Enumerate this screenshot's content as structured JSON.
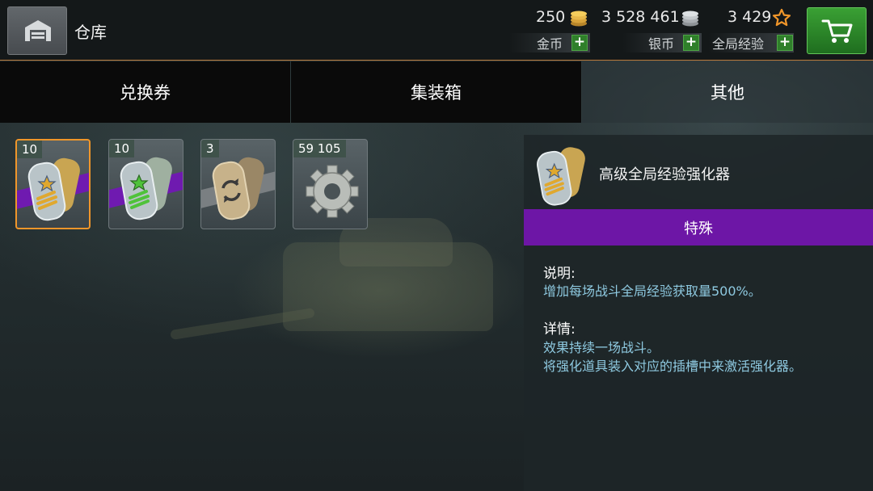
{
  "header": {
    "title": "仓库",
    "gold": {
      "value": "250",
      "label": "金币"
    },
    "silver": {
      "value": "3 528 461",
      "label": "银币"
    },
    "xp": {
      "value": "3 429",
      "label": "全局经验"
    },
    "plus": "+"
  },
  "tabs": [
    {
      "label": "兑换券",
      "active": false
    },
    {
      "label": "集装箱",
      "active": false
    },
    {
      "label": "其他",
      "active": true
    }
  ],
  "items": [
    {
      "count": "10",
      "icon": "xp-booster-dogtag-icon",
      "rarity_color": "#6f1ab0",
      "selected": true
    },
    {
      "count": "10",
      "icon": "crew-xp-booster-dogtag-icon",
      "rarity_color": "#6f1ab0",
      "selected": false
    },
    {
      "count": "3",
      "icon": "exchange-dogtag-icon",
      "rarity_color": "#7a7f82",
      "selected": false
    },
    {
      "count": "59 105",
      "icon": "gear-part-icon",
      "rarity_color": "",
      "selected": false
    }
  ],
  "detail": {
    "name": "高级全局经验强化器",
    "rarity": "特殊",
    "description_title": "说明:",
    "description": "增加每场战斗全局经验获取量500%。",
    "details_title": "详情:",
    "details_line1": "效果持续一场战斗。",
    "details_line2": "将强化道具装入对应的插槽中来激活强化器。"
  },
  "colors": {
    "accent_orange": "#f0962a",
    "rarity_purple": "#6d16a6",
    "buy_green": "#2f7f2a",
    "text_blue": "#8ec9e0"
  }
}
